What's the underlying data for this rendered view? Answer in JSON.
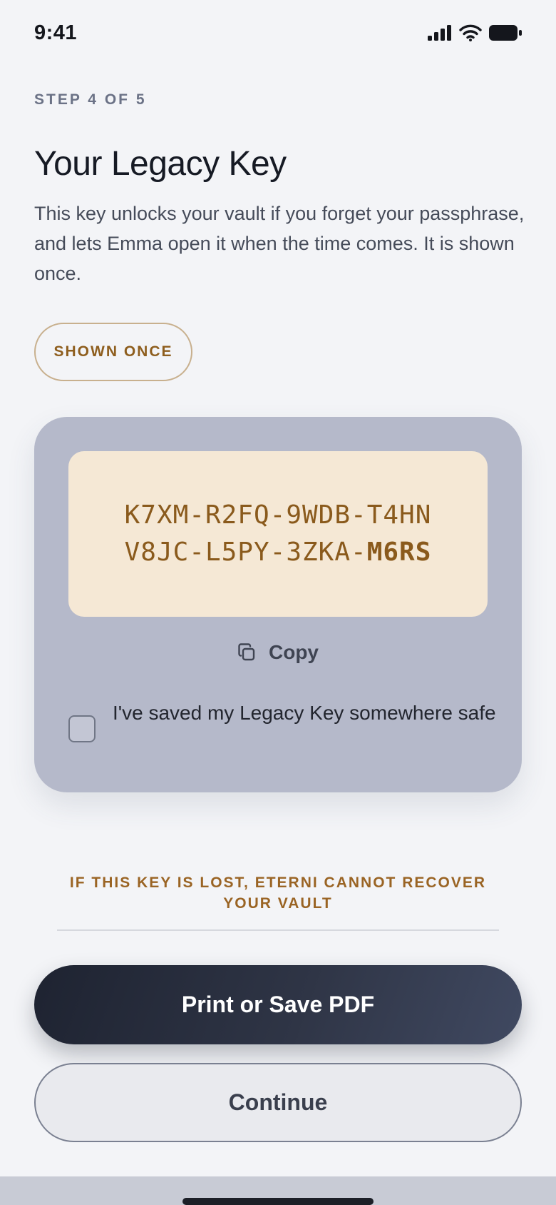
{
  "status_bar": {
    "time": "9:41",
    "icons": [
      "cellular-signal-icon",
      "wifi-icon",
      "battery-icon"
    ]
  },
  "onboarding": {
    "step_label": "STEP 4 OF 5",
    "title": "Your Legacy Key",
    "description": "This key unlocks your vault if you forget your passphrase, and lets Emma open it when the time comes. It is shown once.",
    "badge": "SHOWN ONCE"
  },
  "legacy_key": {
    "line_1": "K7XM-R2FQ-9WDB-T4HN",
    "line_2_regular": "V8JC-L5PY-3ZKA-",
    "line_2_emphasis": "M6RS",
    "copy_label": "Copy",
    "copy_icon": "copy-icon",
    "confirm_label": "I've saved my Legacy Key somewhere safe",
    "confirm_checked": false
  },
  "warning": "IF THIS KEY IS LOST, ETERNI CANNOT RECOVER YOUR VAULT",
  "actions": {
    "primary_label": "Print or Save PDF",
    "secondary_label": "Continue"
  },
  "colors": {
    "background": "#f3f4f7",
    "card": "#b5b9ca",
    "key_box": "#f5e8d5",
    "accent_gold": "#8e5e1e",
    "primary_button": "#1e2331"
  }
}
